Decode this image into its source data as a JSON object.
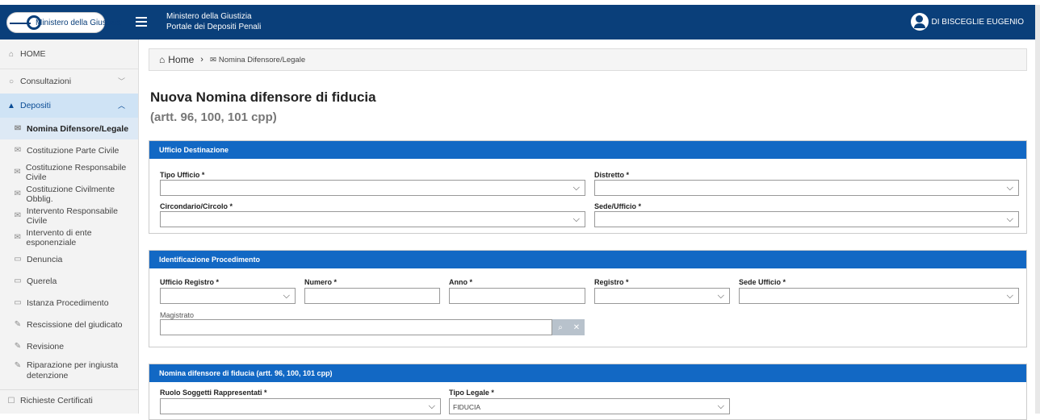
{
  "header": {
    "logo_text": "Ministero della Giustizia",
    "app_line1": "Ministero della Giustizia",
    "app_line2": "Portale dei Depositi Penali",
    "user_name": "DI BISCEGLIE EUGENIO"
  },
  "sidebar": {
    "home": "HOME",
    "consultazioni": "Consultazioni",
    "depositi": "Depositi",
    "items": [
      "Nomina Difensore/Legale",
      "Costituzione Parte Civile",
      "Costituzione Responsabile Civile",
      "Costituzione Civilmente Obblig.",
      "Intervento Responsabile Civile",
      "Intervento di ente esponenziale",
      "Denuncia",
      "Querela",
      "Istanza Procedimento",
      "Rescissione del giudicato",
      "Revisione",
      "Riparazione per ingiusta detenzione",
      "Richieste Certificati"
    ]
  },
  "breadcrumb": {
    "home": "Home",
    "current": "Nomina Difensore/Legale"
  },
  "page": {
    "title": "Nuova Nomina difensore di fiducia",
    "subtitle": "(artt. 96, 100, 101 cpp)"
  },
  "ufficio": {
    "heading": "Ufficio Destinazione",
    "tipo_ufficio": "Tipo Ufficio *",
    "distretto": "Distretto *",
    "circondario": "Circondario/Circolo *",
    "sede_ufficio": "Sede/Ufficio *"
  },
  "procedimento": {
    "heading": "Identificazione Procedimento",
    "ufficio_registro": "Ufficio Registro *",
    "numero": "Numero *",
    "anno": "Anno *",
    "registro": "Registro *",
    "sede_ufficio": "Sede Ufficio *",
    "magistrato": "Magistrato"
  },
  "nomina": {
    "heading": "Nomina difensore di fiducia (artt. 96, 100, 101 cpp)",
    "ruolo": "Ruolo Soggetti Rappresentati *",
    "tipo_legale": "Tipo Legale *",
    "tipo_legale_value": "FIDUCIA"
  },
  "icons": {
    "chevron": "⌵",
    "search": "🔍",
    "clear": "✖"
  }
}
